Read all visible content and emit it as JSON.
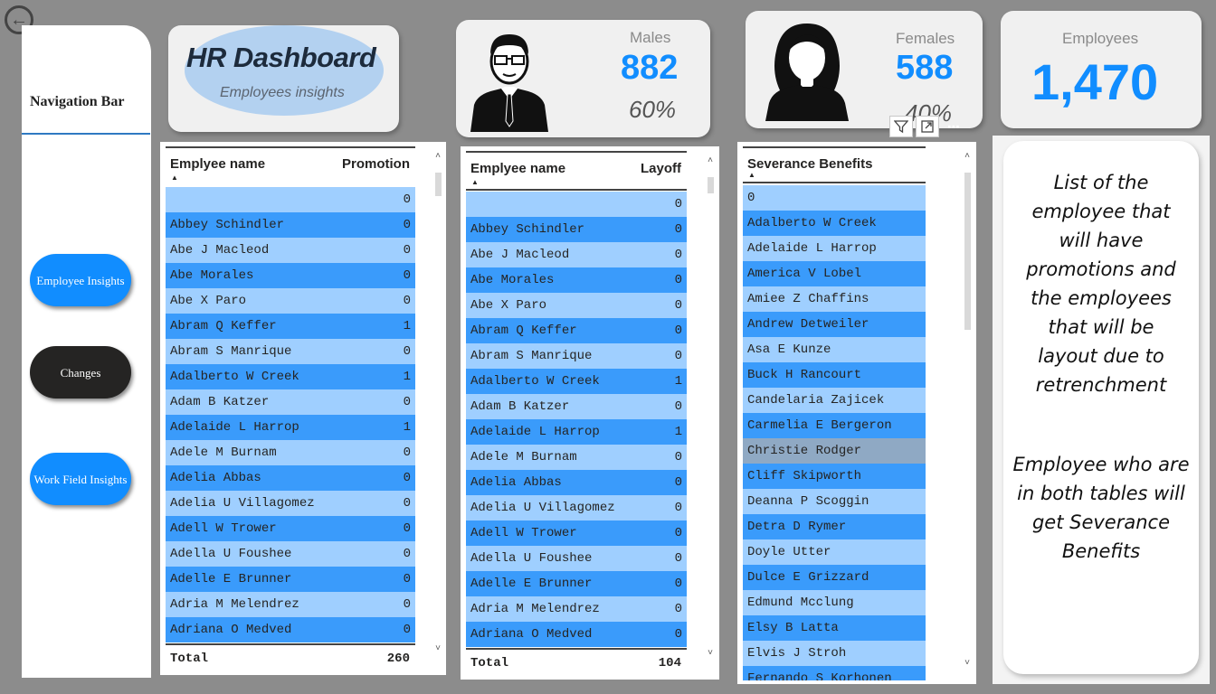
{
  "nav": {
    "title": "Navigation Bar",
    "buttons": [
      {
        "label": "Employee Insights"
      },
      {
        "label": "Changes"
      },
      {
        "label": "Work Field Insights"
      }
    ]
  },
  "header": {
    "title": "HR Dashboard",
    "subtitle": "Employees insights"
  },
  "stats": {
    "males": {
      "label": "Males",
      "value": "882",
      "pct": "60%"
    },
    "females": {
      "label": "Females",
      "value": "588",
      "pct": "40%"
    },
    "employees": {
      "label": "Employees",
      "value": "1,470"
    }
  },
  "colors": {
    "accent": "#118dff",
    "row_light": "#9fcfff",
    "row_dark": "#3a9bfb",
    "nav_dark": "#252423"
  },
  "promotion_table": {
    "col_name": "Emplyee name",
    "col_value": "Promotion",
    "rows": [
      {
        "name": "",
        "value": "0"
      },
      {
        "name": "Abbey Schindler",
        "value": "0"
      },
      {
        "name": "Abe J Macleod",
        "value": "0"
      },
      {
        "name": "Abe Morales",
        "value": "0"
      },
      {
        "name": "Abe X Paro",
        "value": "0"
      },
      {
        "name": "Abram Q Keffer",
        "value": "1"
      },
      {
        "name": "Abram S Manrique",
        "value": "0"
      },
      {
        "name": "Adalberto W Creek",
        "value": "1"
      },
      {
        "name": "Adam B Katzer",
        "value": "0"
      },
      {
        "name": "Adelaide L Harrop",
        "value": "1"
      },
      {
        "name": "Adele M Burnam",
        "value": "0"
      },
      {
        "name": "Adelia Abbas",
        "value": "0"
      },
      {
        "name": "Adelia U Villagomez",
        "value": "0"
      },
      {
        "name": "Adell W Trower",
        "value": "0"
      },
      {
        "name": "Adella U Foushee",
        "value": "0"
      },
      {
        "name": "Adelle E Brunner",
        "value": "0"
      },
      {
        "name": "Adria M Melendrez",
        "value": "0"
      },
      {
        "name": "Adriana O Medved",
        "value": "0"
      }
    ],
    "total_label": "Total",
    "total_value": "260"
  },
  "layoff_table": {
    "col_name": "Emplyee name",
    "col_value": "Layoff",
    "rows": [
      {
        "name": "",
        "value": "0"
      },
      {
        "name": "Abbey Schindler",
        "value": "0"
      },
      {
        "name": "Abe J Macleod",
        "value": "0"
      },
      {
        "name": "Abe Morales",
        "value": "0"
      },
      {
        "name": "Abe X Paro",
        "value": "0"
      },
      {
        "name": "Abram Q Keffer",
        "value": "0"
      },
      {
        "name": "Abram S Manrique",
        "value": "0"
      },
      {
        "name": "Adalberto W Creek",
        "value": "1"
      },
      {
        "name": "Adam B Katzer",
        "value": "0"
      },
      {
        "name": "Adelaide L Harrop",
        "value": "1"
      },
      {
        "name": "Adele M Burnam",
        "value": "0"
      },
      {
        "name": "Adelia Abbas",
        "value": "0"
      },
      {
        "name": "Adelia U Villagomez",
        "value": "0"
      },
      {
        "name": "Adell W Trower",
        "value": "0"
      },
      {
        "name": "Adella U Foushee",
        "value": "0"
      },
      {
        "name": "Adelle E Brunner",
        "value": "0"
      },
      {
        "name": "Adria M Melendrez",
        "value": "0"
      },
      {
        "name": "Adriana O Medved",
        "value": "0"
      }
    ],
    "total_label": "Total",
    "total_value": "104"
  },
  "severance_table": {
    "col_name": "Severance Benefits",
    "rows": [
      "0",
      "Adalberto W Creek",
      "Adelaide L Harrop",
      "America V Lobel",
      "Amiee Z Chaffins",
      "Andrew Detweiler",
      "Asa E Kunze",
      "Buck H Rancourt",
      "Candelaria Zajicek",
      "Carmelia E Bergeron",
      "Christie Rodger",
      "Cliff Skipworth",
      "Deanna P Scoggin",
      "Detra D Rymer",
      "Doyle Utter",
      "Dulce E Grizzard",
      "Edmund Mcclung",
      "Elsy B Latta",
      "Elvis J Stroh",
      "Fernando S Korhonen"
    ],
    "selected_index": 10
  },
  "info": {
    "paragraph1": "List of the employee that will have promotions and the employees that will be layout due to retrenchment",
    "paragraph2": "Employee who are in both tables will get Severance Benefits"
  },
  "icons": {
    "back": "back-arrow-icon",
    "filter": "filter-icon",
    "focus": "focus-mode-icon",
    "more": "more-options-icon",
    "male": "male-person-icon",
    "female": "female-person-icon"
  }
}
